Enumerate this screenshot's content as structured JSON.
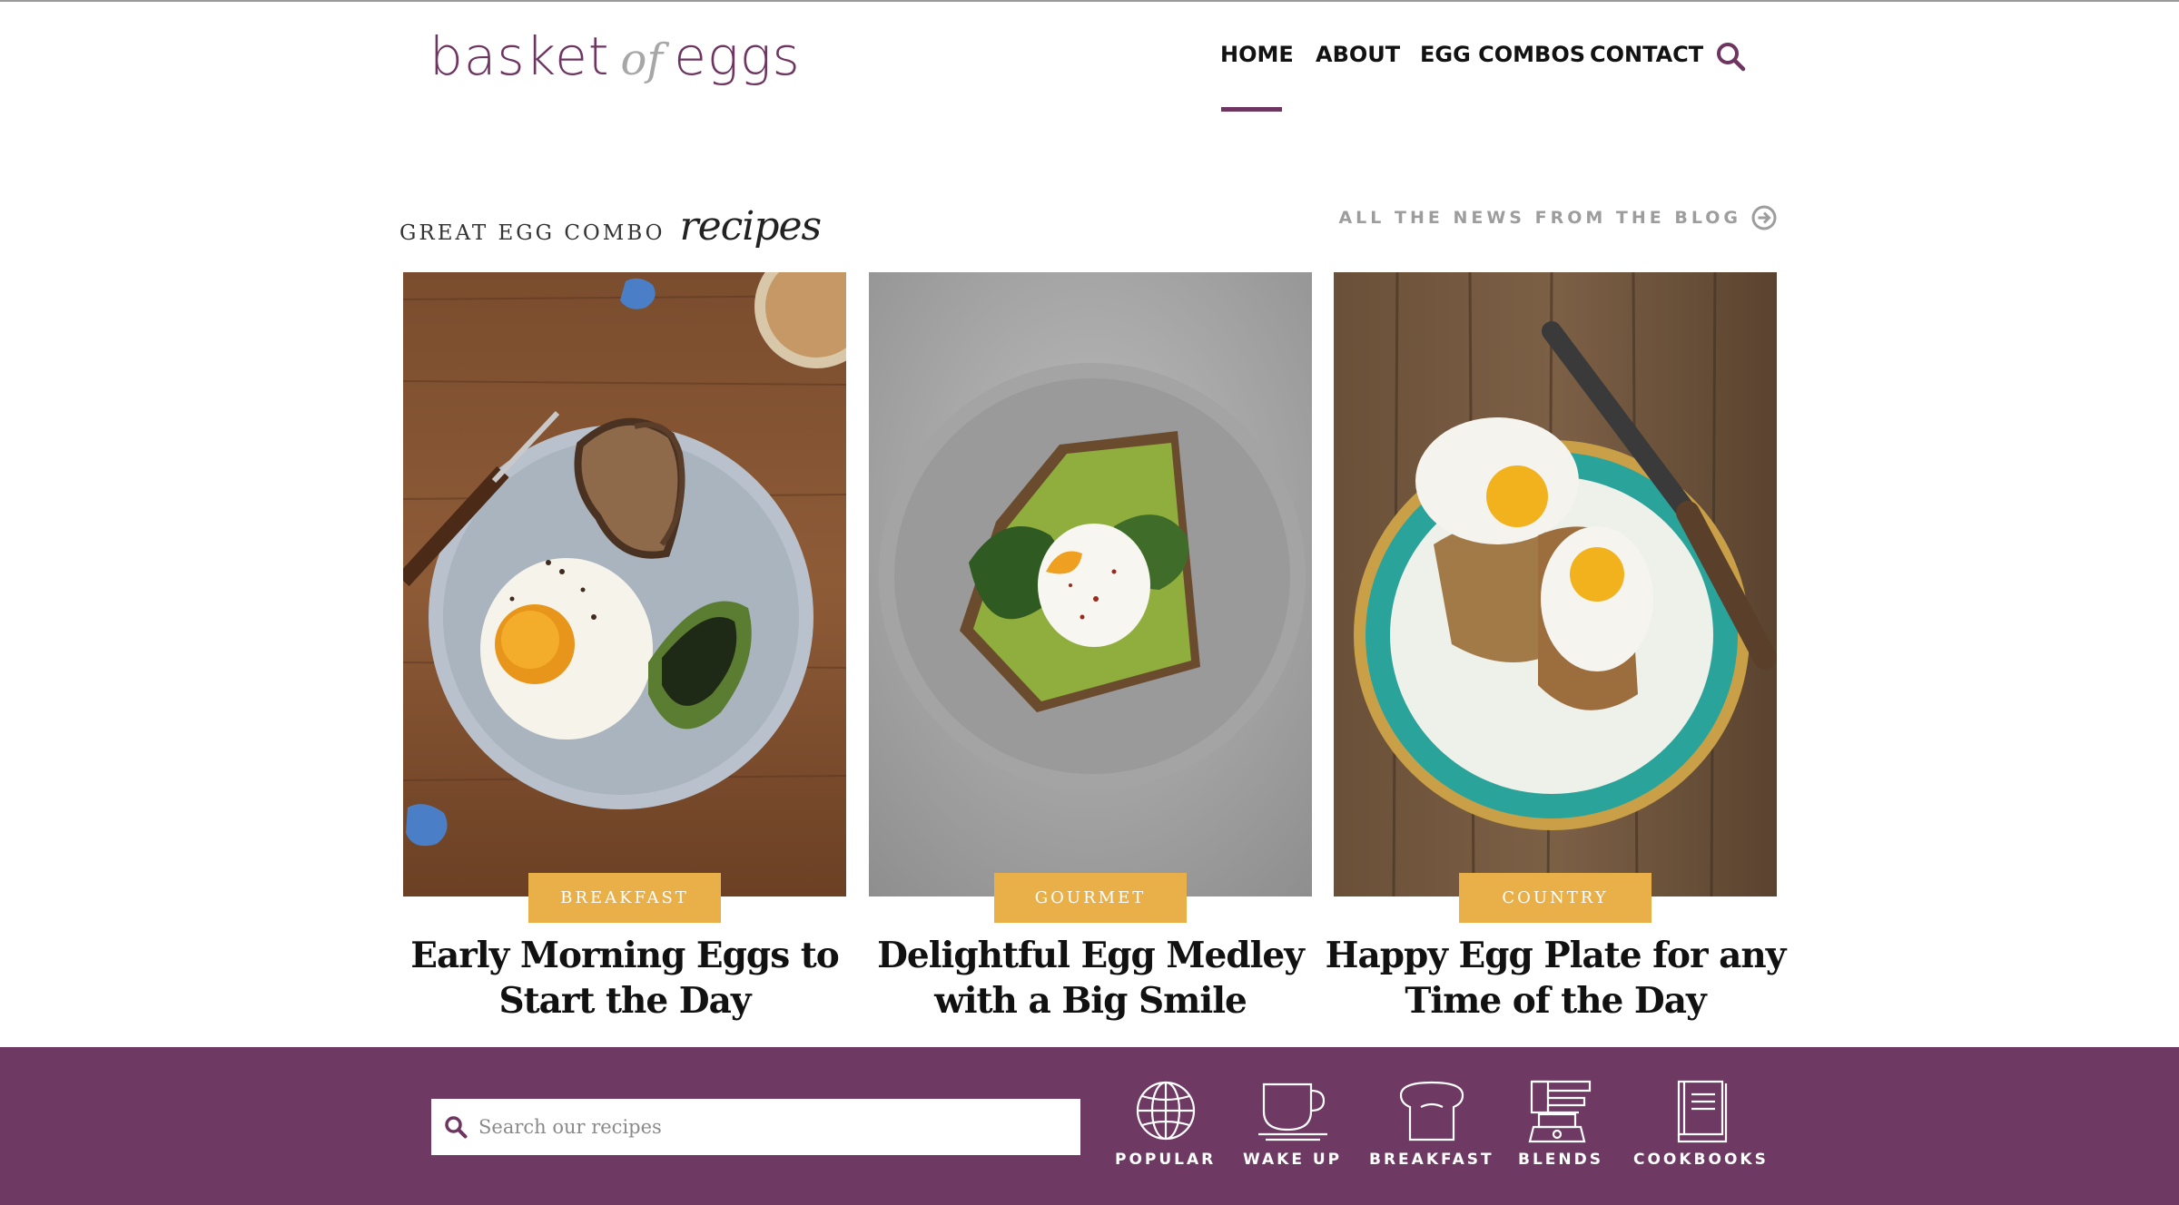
{
  "logo": {
    "word1": "basket",
    "word2": "of",
    "word3": "eggs"
  },
  "nav": {
    "items": [
      {
        "label": "HOME",
        "active": true
      },
      {
        "label": "ABOUT",
        "active": false
      },
      {
        "label": "EGG COMBOS",
        "active": false
      },
      {
        "label": "CONTACT",
        "active": false
      }
    ],
    "search_icon": "search-icon"
  },
  "section": {
    "title": "GREAT EGG COMBO",
    "title_script": "recipes",
    "blog_link": "ALL THE NEWS FROM THE BLOG",
    "blog_link_icon": "arrow-circle-right-icon"
  },
  "cards": [
    {
      "category": "BREAKFAST",
      "title_line1": "Early Morning Eggs to",
      "title_line2": "Start the Day"
    },
    {
      "category": "GOURMET",
      "title_line1": "Delightful Egg Medley",
      "title_line2": "with a Big Smile"
    },
    {
      "category": "COUNTRY",
      "title_line1": "Happy Egg Plate for any",
      "title_line2": "Time of the Day"
    }
  ],
  "footer": {
    "search_placeholder": "Search our recipes",
    "categories": [
      {
        "label": "POPULAR",
        "icon": "globe-icon"
      },
      {
        "label": "WAKE UP",
        "icon": "coffee-cup-icon"
      },
      {
        "label": "BREAKFAST",
        "icon": "bread-icon"
      },
      {
        "label": "BLENDS",
        "icon": "blender-icon"
      },
      {
        "label": "COOKBOOKS",
        "icon": "book-icon"
      }
    ]
  },
  "colors": {
    "brand": "#6d3560",
    "footer_bg": "#6e3962",
    "badge": "#e9b04a",
    "muted": "#9d9d9d"
  }
}
